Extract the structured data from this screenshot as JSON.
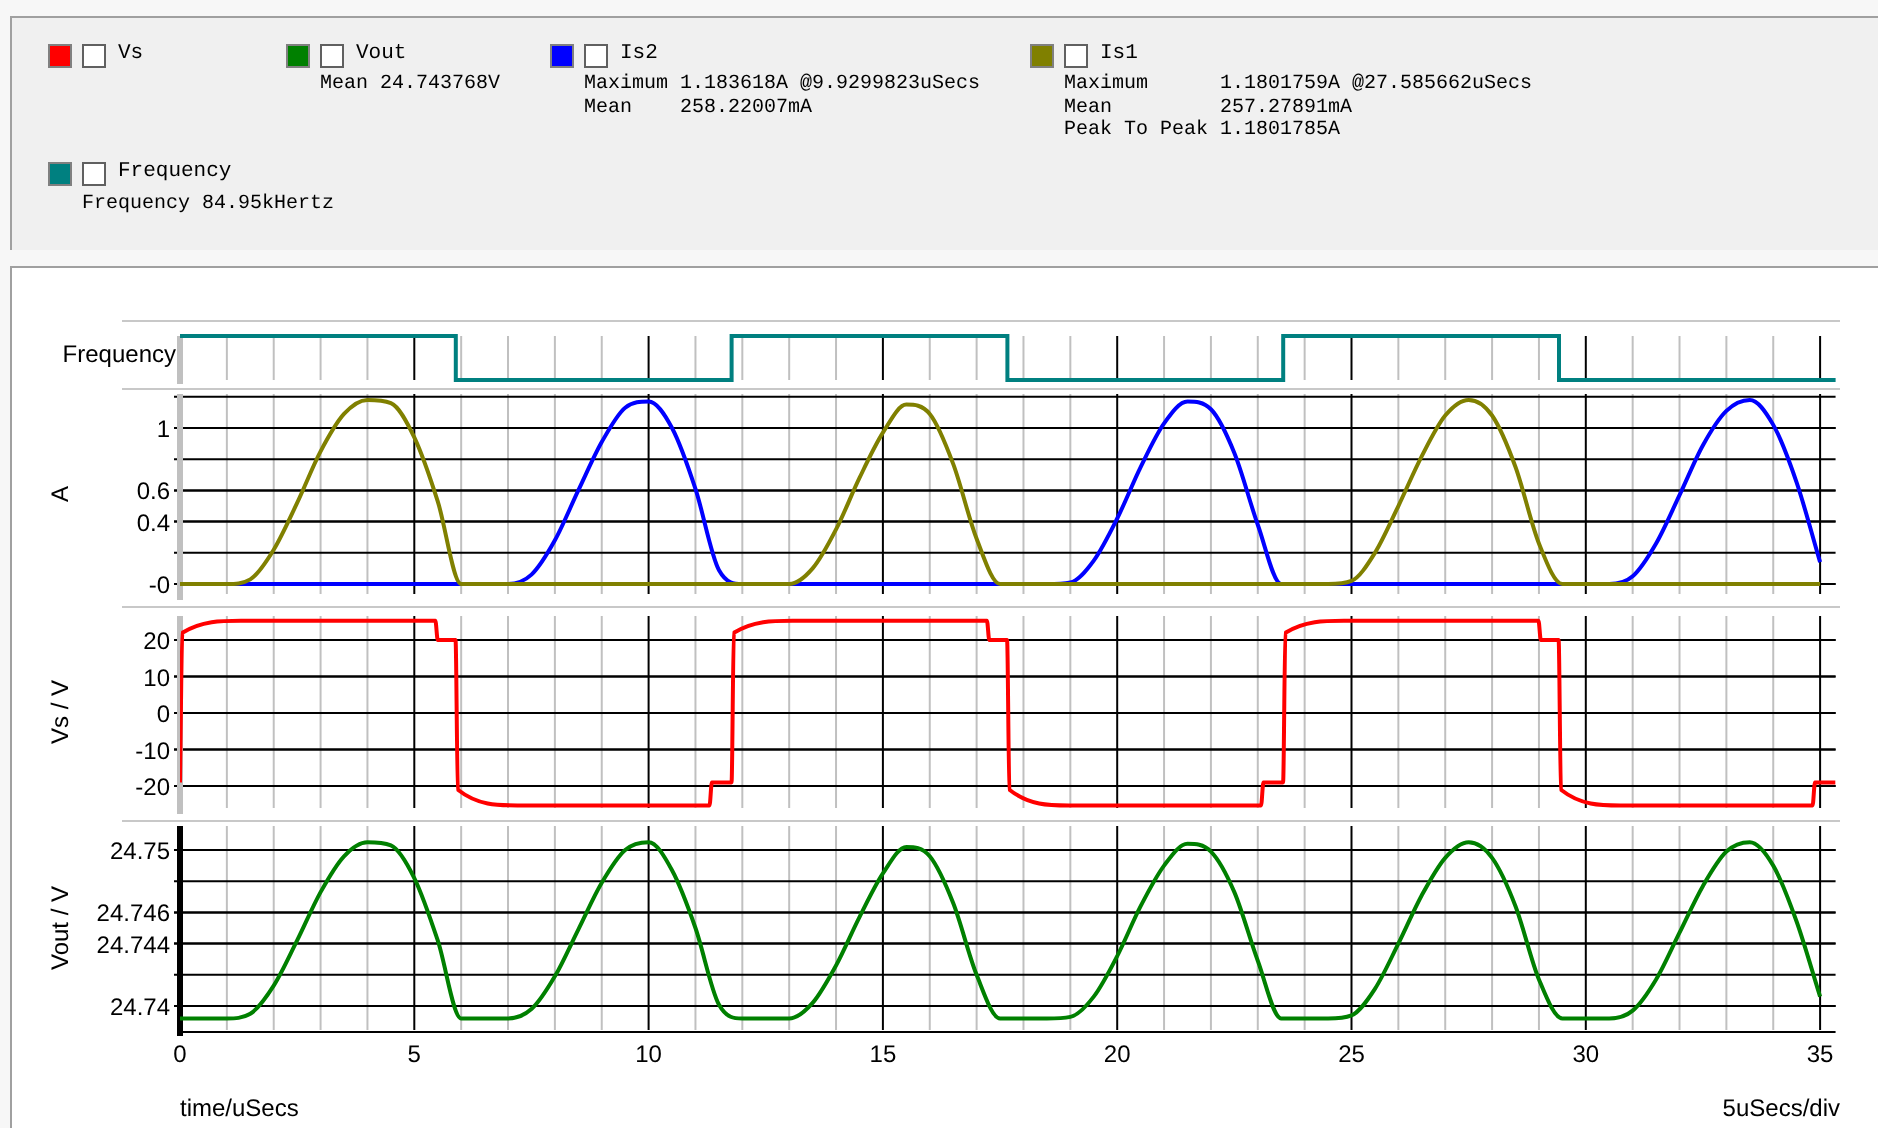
{
  "legend": {
    "traces": [
      {
        "name": "Vs",
        "color": "#ff0000",
        "checked": false
      },
      {
        "name": "Vout",
        "color": "#008000",
        "checked": false,
        "stats": [
          "Mean 24.743768V"
        ]
      },
      {
        "name": "Is2",
        "color": "#0000ff",
        "checked": false,
        "stats": [
          "Maximum 1.183618A @9.9299823uSecs",
          "Mean    258.22007mA"
        ]
      },
      {
        "name": "Is1",
        "color": "#808000",
        "checked": false,
        "stats": [
          "Maximum      1.1801759A @27.585662uSecs",
          "Mean         257.27891mA",
          "Peak To Peak 1.1801785A"
        ]
      },
      {
        "name": "Frequency",
        "color": "#008080",
        "checked": false,
        "stats": [
          "Frequency 84.95kHertz"
        ]
      }
    ]
  },
  "plot": {
    "panels": [
      {
        "kind": "digital",
        "label": "Frequency",
        "color": "#008080"
      },
      {
        "kind": "analog",
        "chart_data": {
          "type": "line",
          "ylabel": "A",
          "xlim": [
            0,
            35.33
          ],
          "ylim": [
            -0.064,
            1.218
          ],
          "grid": true,
          "yticks": [
            {
              "value": 1,
              "label": "1"
            },
            {
              "value": 0.6,
              "label": "0.6"
            },
            {
              "value": 0.4,
              "label": "0.4"
            },
            {
              "value": 0,
              "label": "-0"
            }
          ],
          "x": [
            0,
            0.5,
            1,
            1.5,
            2,
            2.5,
            3,
            3.5,
            4,
            4.5,
            5,
            5.5,
            6,
            6.5,
            7,
            7.5,
            8,
            8.5,
            9,
            9.5,
            10,
            10.5,
            11,
            11.5,
            12,
            12.5,
            13,
            13.5,
            14,
            14.5,
            15,
            15.5,
            16,
            16.5,
            17,
            17.5,
            18,
            18.5,
            19,
            19.5,
            20,
            20.5,
            21,
            21.5,
            22,
            22.5,
            23,
            23.5,
            24,
            24.5,
            25,
            25.5,
            26,
            26.5,
            27,
            27.5,
            28,
            28.5,
            29,
            29.5,
            30,
            30.5,
            31,
            31.5,
            32,
            32.5,
            33,
            33.5,
            34,
            34.5,
            35
          ],
          "series": [
            {
              "color": "#0000ff",
              "values": [
                0,
                0,
                0,
                0,
                0,
                0,
                0,
                0,
                0,
                0,
                0,
                0,
                0,
                0,
                0,
                0.06,
                0.28,
                0.6,
                0.91,
                1.13,
                1.17,
                1,
                0.61,
                0.09,
                0,
                0,
                0,
                0,
                0,
                0,
                0,
                0,
                0,
                0,
                0,
                0,
                0,
                0,
                0.01,
                0.15,
                0.42,
                0.75,
                1.03,
                1.17,
                1.12,
                0.84,
                0.38,
                0,
                0,
                0,
                0,
                0,
                0,
                0,
                0,
                0,
                0,
                0,
                0,
                0,
                0,
                0,
                0.05,
                0.26,
                0.57,
                0.89,
                1.11,
                1.18,
                1.02,
                0.65,
                0.14
              ]
            },
            {
              "color": "#808000",
              "values": [
                0,
                0,
                0,
                0.03,
                0.22,
                0.52,
                0.85,
                1.09,
                1.18,
                1.16,
                0.94,
                0.53,
                0,
                0,
                0,
                0,
                0,
                0,
                0,
                0,
                0,
                0,
                0,
                0,
                0,
                0,
                0,
                0.1,
                0.35,
                0.68,
                0.97,
                1.15,
                1.09,
                0.77,
                0.29,
                0,
                0,
                0,
                0,
                0,
                0,
                0,
                0,
                0,
                0,
                0,
                0,
                0,
                0,
                0,
                0.02,
                0.2,
                0.5,
                0.82,
                1.08,
                1.18,
                1.08,
                0.75,
                0.26,
                0,
                0,
                0,
                0,
                0,
                0,
                0,
                0,
                0,
                0,
                0,
                0
              ]
            }
          ]
        }
      },
      {
        "kind": "analog",
        "chart_data": {
          "type": "line",
          "ylabel": "Vs / V",
          "xlim": [
            0,
            35.33
          ],
          "ylim": [
            -26,
            26.6
          ],
          "grid": true,
          "yticks": [
            20,
            10,
            0,
            -10,
            -20
          ],
          "x": [
            0,
            0.05,
            1.3,
            5.45,
            5.5,
            5.88,
            5.93,
            7.2,
            11.3,
            11.35,
            11.72,
            11.77,
            11.82,
            13.07,
            17.22,
            17.27,
            17.65,
            17.7,
            18.97,
            23.07,
            23.12,
            23.54,
            23.59,
            24.84,
            28.99,
            29.04,
            29.42,
            29.47,
            30.74,
            34.84,
            34.89,
            35.33
          ],
          "series": [
            {
              "color": "#ff0000",
              "values": [
                -19,
                22,
                25.3,
                25.3,
                20,
                20,
                -21,
                -25.3,
                -25.3,
                -19,
                -19,
                -19,
                22,
                25.3,
                25.3,
                20,
                20,
                -21,
                -25.3,
                -25.3,
                -19,
                -19,
                22,
                25.3,
                25.3,
                20,
                20,
                -21,
                -25.3,
                -25.3,
                -19,
                -19
              ]
            }
          ]
        }
      },
      {
        "kind": "analog",
        "chart_data": {
          "type": "line",
          "ylabel": "Vout / V",
          "xlabel": "time/uSecs",
          "xlim": [
            0,
            35.33
          ],
          "ylim": [
            24.73846,
            24.75154
          ],
          "grid": true,
          "yticks": [
            {
              "value": 24.75,
              "label": "24.75"
            },
            {
              "value": 24.746,
              "label": "24.746"
            },
            {
              "value": 24.744,
              "label": "24.744"
            },
            {
              "value": 24.74,
              "label": "24.74"
            }
          ],
          "xticks": [
            0,
            5,
            10,
            15,
            20,
            25,
            30,
            35
          ],
          "x": [
            0,
            0.5,
            1,
            1.5,
            2,
            2.5,
            3,
            3.5,
            4,
            4.5,
            5,
            5.5,
            6,
            6.5,
            7,
            7.5,
            8,
            8.5,
            9,
            9.5,
            10,
            10.5,
            11,
            11.5,
            12,
            12.5,
            13,
            13.5,
            14,
            14.5,
            15,
            15.5,
            16,
            16.5,
            17,
            17.5,
            18,
            18.5,
            19,
            19.5,
            20,
            20.5,
            21,
            21.5,
            22,
            22.5,
            23,
            23.5,
            24,
            24.5,
            25,
            25.5,
            26,
            26.5,
            27,
            27.5,
            28,
            28.5,
            29,
            29.5,
            30,
            30.5,
            31,
            31.5,
            32,
            32.5,
            33,
            33.5,
            34,
            34.5,
            35
          ],
          "series": [
            {
              "color": "#008000",
              "values": [
                24.7392,
                24.7392,
                24.7392,
                24.7395,
                24.7413,
                24.7442,
                24.7473,
                24.7496,
                24.7505,
                24.7503,
                24.7482,
                24.7442,
                24.7392,
                24.7392,
                24.7392,
                24.7398,
                24.7419,
                24.7449,
                24.7479,
                24.75,
                24.7505,
                24.7487,
                24.745,
                24.7401,
                24.7392,
                24.7392,
                24.7392,
                24.7402,
                24.7426,
                24.7457,
                24.7485,
                24.7502,
                24.7496,
                24.7466,
                24.742,
                24.7392,
                24.7392,
                24.7392,
                24.7393,
                24.7406,
                24.7432,
                24.7464,
                24.749,
                24.7504,
                24.7499,
                24.7473,
                24.7429,
                24.7392,
                24.7392,
                24.7392,
                24.7394,
                24.7411,
                24.744,
                24.7471,
                24.7495,
                24.7505,
                24.7495,
                24.7464,
                24.7417,
                24.7392,
                24.7392,
                24.7392,
                24.7397,
                24.7417,
                24.7447,
                24.7477,
                24.7499,
                24.7505,
                24.749,
                24.7454,
                24.7406
              ]
            }
          ]
        }
      }
    ],
    "division": "5uSecs/div"
  }
}
